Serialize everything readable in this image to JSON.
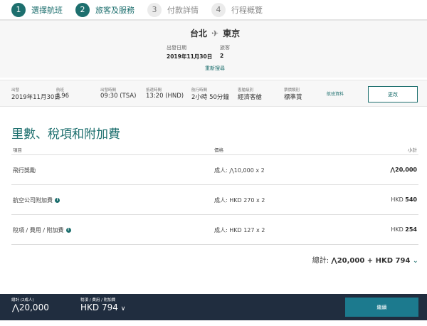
{
  "steps": [
    {
      "num": "1",
      "label": "選擇航班"
    },
    {
      "num": "2",
      "label": "旅客及服務"
    },
    {
      "num": "3",
      "label": "付款詳情"
    },
    {
      "num": "4",
      "label": "行程概覽"
    }
  ],
  "search": {
    "from": "台北",
    "to": "東京",
    "date_label": "出發日期",
    "date": "2019年11月30日",
    "pax_label": "旅客",
    "pax": "2",
    "research": "重新搜尋"
  },
  "flight": {
    "dep_label": "出發",
    "dep": "2019年11月30日",
    "flight_label": "航班",
    "flight": "JL96",
    "deptime_label": "出發時間",
    "deptime": "09:30 (TSA)",
    "arrtime_label": "抵達時間",
    "arrtime": "13:20 (HND)",
    "dur_label": "航行時間",
    "dur": "2小時 50分鐘",
    "cabin_label": "客艙級別",
    "cabin": "經濟客艙",
    "fare_label": "票價類別",
    "fare": "標準賞",
    "info": "航班資料",
    "change": "更改"
  },
  "main": {
    "title": "里數、稅項和附加費",
    "headers": [
      "項目",
      "價格",
      "小計"
    ],
    "rows": [
      {
        "item": "飛行獎勵",
        "price": "成人: ⋀10,000 x 2",
        "cur": "⋀",
        "amount": "20,000",
        "info": false
      },
      {
        "item": "航空公司附加費",
        "price": "成人: HKD 270 x 2",
        "cur": "HKD ",
        "amount": "540",
        "info": true
      },
      {
        "item": "稅項 / 費用 / 附加費",
        "price": "成人: HKD 127 x 2",
        "cur": "HKD ",
        "amount": "254",
        "info": true
      }
    ],
    "total_label": "總計:",
    "total": "⋀20,000 + HKD 794"
  },
  "footer": {
    "total_label": "總計 (2成人)",
    "total": "⋀20,000",
    "tax_label": "稅項 / 費用 / 附加費",
    "tax": "HKD 794",
    "continue": "繼續"
  }
}
